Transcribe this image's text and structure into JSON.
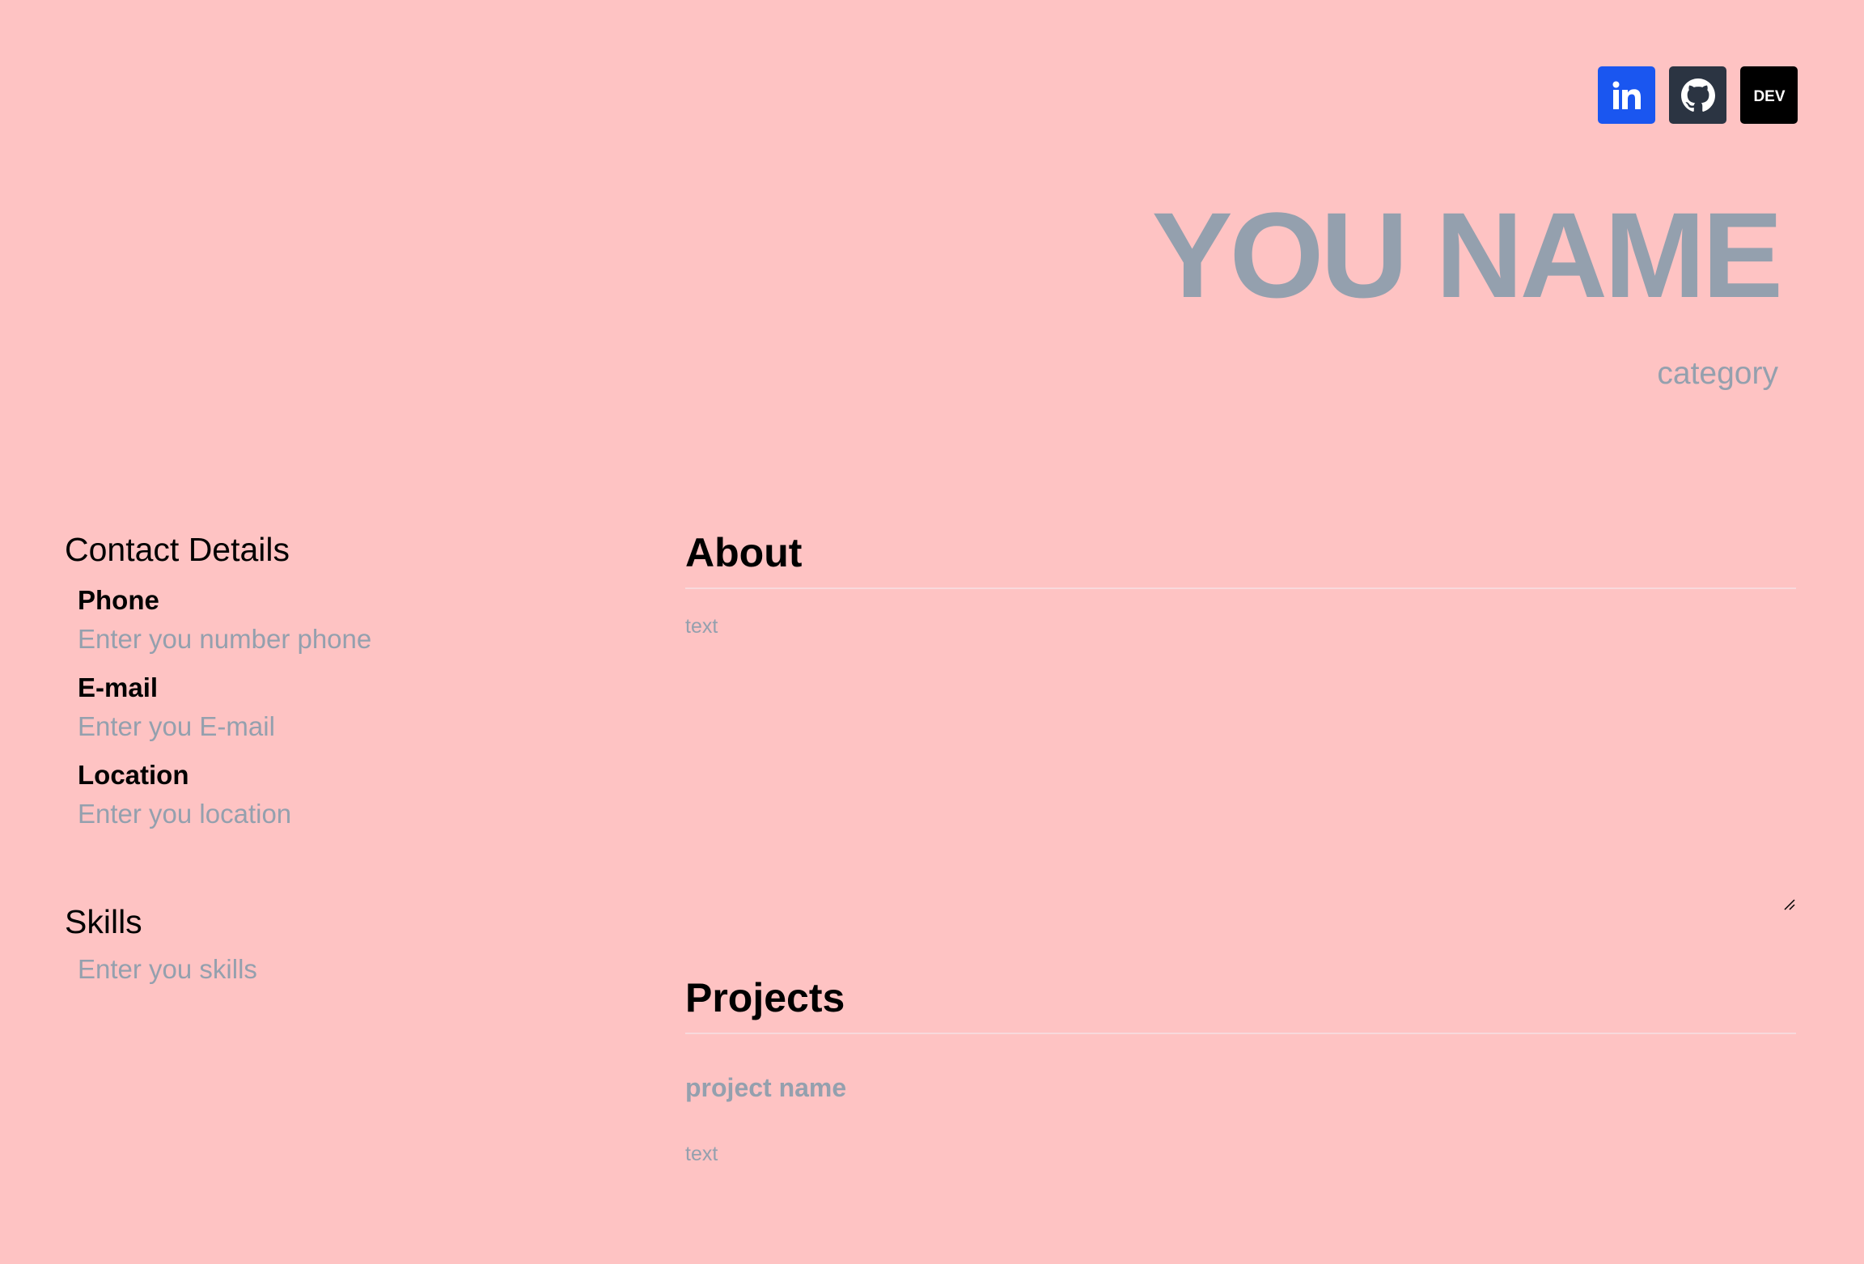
{
  "socials": {
    "linkedin_icon": "linkedin-icon",
    "github_icon": "github-icon",
    "dev_icon": "dev-icon",
    "dev_label": "DEV"
  },
  "header": {
    "name": "YOU NAME",
    "category": "category"
  },
  "contact": {
    "title": "Contact Details",
    "phone_label": "Phone",
    "phone_placeholder": "Enter you number phone",
    "email_label": "E-mail",
    "email_placeholder": "Enter you E-mail",
    "location_label": "Location",
    "location_placeholder": "Enter you location"
  },
  "skills": {
    "title": "Skills",
    "placeholder": "Enter you skills"
  },
  "about": {
    "title": "About",
    "text": "text"
  },
  "projects": {
    "title": "Projects",
    "items": [
      {
        "name": "project name",
        "text": "text"
      }
    ]
  },
  "colors": {
    "background": "#fec3c3",
    "muted_text": "#94a0ae",
    "linkedin": "#1a56f0",
    "github": "#2b3442",
    "dev": "#000000"
  }
}
